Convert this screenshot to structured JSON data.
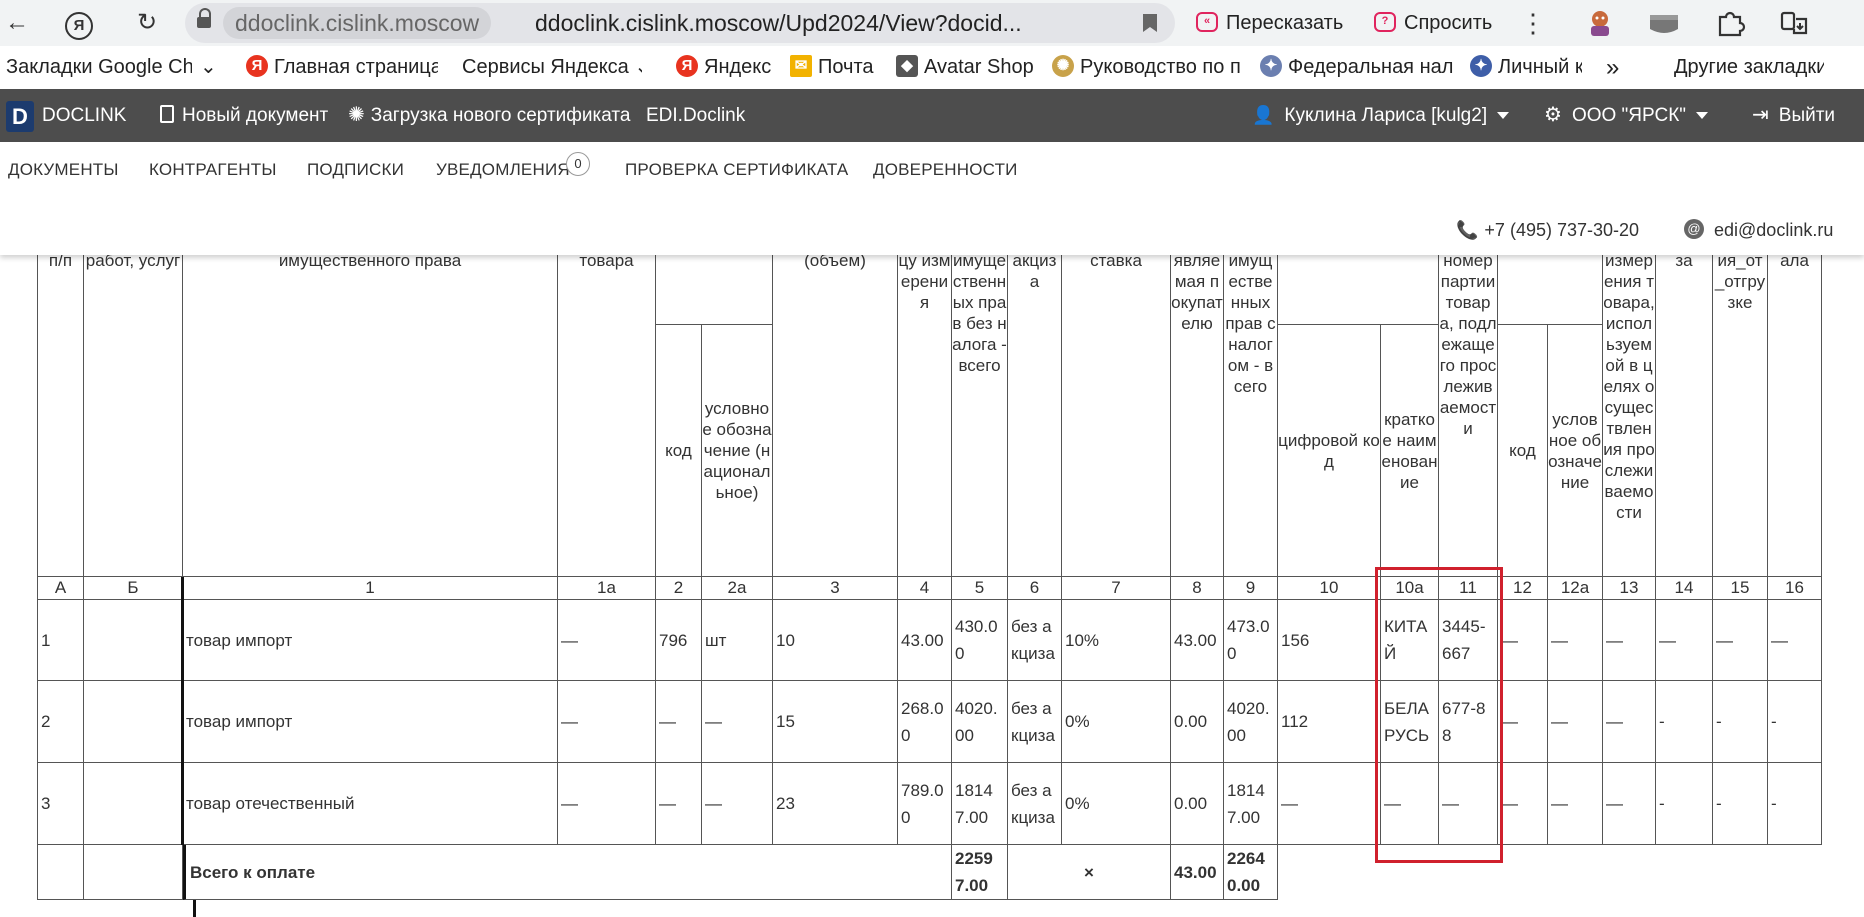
{
  "browser": {
    "domain": "ddoclink.cislink.moscow",
    "url": "ddoclink.cislink.moscow/Upd2024/View?docid...",
    "retell_label": "Пересказать",
    "ask_label": "Спросить",
    "bookmarks": [
      "Закладки Google Ch",
      "Главная страница",
      "Сервисы Яндекса",
      "Яндекс",
      "Почта",
      "Avatar Shop",
      "Руководство по п",
      "Федеральная нал",
      "Личный к",
      "Другие закладки"
    ],
    "more_bookmarks": "»"
  },
  "app": {
    "brand": "DOCLINK",
    "brand_mark": "D",
    "nav": {
      "new_doc": "Новый документ",
      "upload_cert": "Загрузка нового сертификата",
      "edi": "EDI.Doclink",
      "user": "Куклина Лариса [kulg2]",
      "org": "ООО \"ЯРСК\"",
      "logout": "Выйти"
    },
    "menu": [
      "ДОКУМЕНТЫ",
      "КОНТРАГЕНТЫ",
      "ПОДПИСКИ",
      "УВЕДОМЛЕНИЯ",
      "ПРОВЕРКА СЕРТИФИКАТА",
      "ДОВЕРЕННОСТИ"
    ],
    "notifications_count": "0",
    "phone": "+7 (495) 737-30-20",
    "email": "edi@doclink.ru"
  },
  "table": {
    "header_top": {
      "c0": "п/п",
      "c1": "работ, услуг",
      "c2": "имущественного права",
      "c3": "товара",
      "c6": "(объем)",
      "c7": "цу измерения",
      "c8": "имущественных прав без налога - всего",
      "c9": "акциза",
      "c10": "ставка",
      "c11": "являемая покупателю",
      "c12": "имущественных прав с налогом - всего",
      "c15": "номер партии товара, подлежащего прослеживаемости",
      "c18": "измерения товара, используемой в целях осуществления прослеживаемости",
      "c19": "за",
      "c20": "ия_от_отгрузке",
      "c21": "ала"
    },
    "header_sub": {
      "c4": "код",
      "c5": "условное обозначение (национальное)",
      "c13": "цифровой код",
      "c14": "краткое наименование",
      "c16": "код",
      "c17": "условное обозначение"
    },
    "col_numbers": [
      "А",
      "Б",
      "1",
      "1а",
      "2",
      "2а",
      "3",
      "4",
      "5",
      "6",
      "7",
      "8",
      "9",
      "10",
      "10а",
      "11",
      "12",
      "12а",
      "13",
      "14",
      "15",
      "16"
    ],
    "rows": [
      [
        "1",
        "",
        "товар импорт",
        "—",
        "796",
        "шт",
        "10",
        "43.00",
        "430.00",
        "без акциза",
        "10%",
        "43.00",
        "473.00",
        "156",
        "КИТАЙ",
        "3445-667",
        "—",
        "—",
        "—",
        "—",
        "—",
        "—"
      ],
      [
        "2",
        "",
        "товар импорт",
        "—",
        "—",
        "—",
        "15",
        "268.00",
        "4020.00",
        "без акциза",
        "0%",
        "0.00",
        "4020.00",
        "112",
        "БЕЛАРУСЬ",
        "677-88",
        "—",
        "—",
        "—",
        "-",
        "-",
        "-"
      ],
      [
        "3",
        "",
        "товар отечественный",
        "—",
        "—",
        "—",
        "23",
        "789.00",
        "18147.00",
        "без акциза",
        "0%",
        "0.00",
        "18147.00",
        "—",
        "—",
        "—",
        "—",
        "—",
        "—",
        "-",
        "-",
        "-"
      ]
    ],
    "total": {
      "label": "Всего к оплате",
      "amount_no_tax": "22597.00",
      "excise": "×",
      "tax": "43.00",
      "amount_with_tax": "22640.00"
    }
  }
}
